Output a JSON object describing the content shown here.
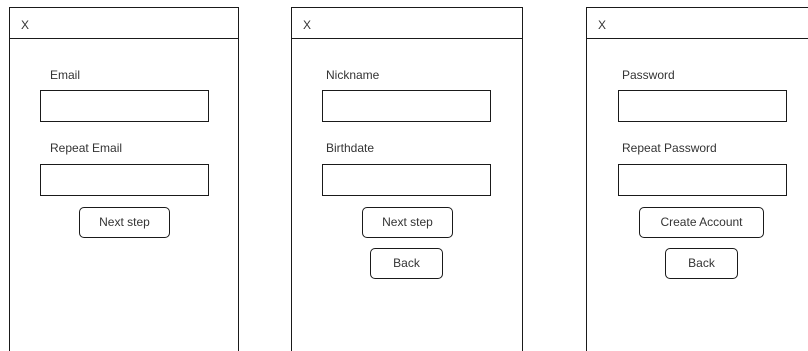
{
  "screens": [
    {
      "close_label": "X",
      "fields": [
        {
          "label": "Email",
          "value": ""
        },
        {
          "label": "Repeat Email",
          "value": ""
        }
      ],
      "buttons": [
        {
          "label": "Next step"
        }
      ]
    },
    {
      "close_label": "X",
      "fields": [
        {
          "label": "Nickname",
          "value": ""
        },
        {
          "label": "Birthdate",
          "value": ""
        }
      ],
      "buttons": [
        {
          "label": "Next step"
        },
        {
          "label": "Back"
        }
      ]
    },
    {
      "close_label": "X",
      "fields": [
        {
          "label": "Password",
          "value": ""
        },
        {
          "label": "Repeat Password",
          "value": ""
        }
      ],
      "buttons": [
        {
          "label": "Create Account"
        },
        {
          "label": "Back"
        }
      ]
    }
  ]
}
